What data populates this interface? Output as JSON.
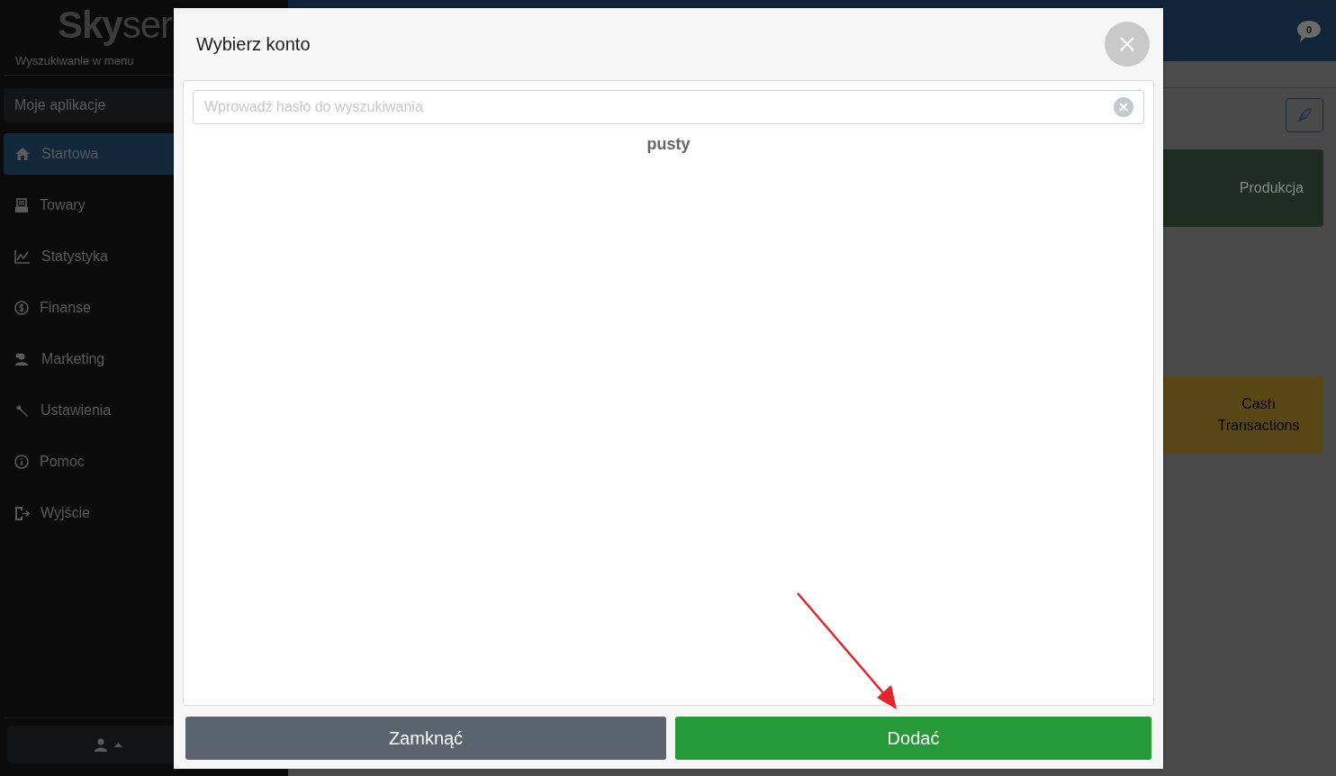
{
  "sidebar": {
    "logo": "**Sky**ser",
    "search_label": "Wyszukiwanie w menu",
    "section": "Moje aplikacje",
    "items": [
      {
        "label": "Startowa",
        "selected": true
      },
      {
        "label": "Towary",
        "selected": false
      },
      {
        "label": "Statystyka",
        "selected": false
      },
      {
        "label": "Finanse",
        "selected": false
      },
      {
        "label": "Marketing",
        "selected": false
      },
      {
        "label": "Ustawienia",
        "selected": false
      },
      {
        "label": "Pomoc",
        "selected": false
      },
      {
        "label": "Wyjście",
        "selected": false
      }
    ]
  },
  "header": {
    "notifications": "0"
  },
  "tiles": [
    {
      "label": "Produkcja",
      "color": "#1f2c21"
    },
    {
      "label": "Cash Transactions",
      "color": "#5a4716"
    }
  ],
  "modal": {
    "title": "Wybierz konto",
    "search": {
      "placeholder": "Wprowadź hasło do wyszukiwania"
    },
    "empty_text": "pusty",
    "buttons": [
      {
        "label": "Zamknąć",
        "kind": "secondary"
      },
      {
        "label": "Dodać",
        "kind": "primary"
      }
    ]
  }
}
